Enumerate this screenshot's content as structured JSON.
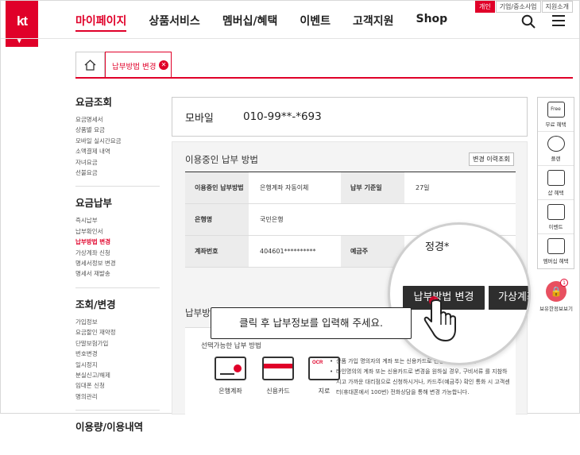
{
  "header": {
    "logo": "kt",
    "nav": [
      "마이페이지",
      "상품서비스",
      "멤버십/혜택",
      "이벤트",
      "고객지원",
      "Shop"
    ],
    "utility": [
      "개인",
      "기업/중소사업",
      "지원소개"
    ]
  },
  "tabs": {
    "active_tab": "납부방법 변경"
  },
  "sidebar": [
    {
      "title": "요금조회",
      "items": [
        "요금명세서",
        "상품별 요금",
        "모바일 실시간요금",
        "소액결제 내역",
        "자녀요금",
        "선불요금"
      ]
    },
    {
      "title": "요금납부",
      "items": [
        "즉시납부",
        "납부확인서",
        "납부방법 변경",
        "가상계좌 신청",
        "명세서정보 변경",
        "명세서 재발송"
      ],
      "active": "납부방법 변경"
    },
    {
      "title": "조회/변경",
      "items": [
        "가입정보",
        "요금할인 재약정",
        "단말보험가입",
        "번호변경",
        "일시정지",
        "분실신고/해제",
        "임대폰 신청",
        "명의관리"
      ]
    },
    {
      "title": "이용량/이용내역",
      "items": []
    }
  ],
  "mobile": {
    "label": "모바일",
    "number": "010-99**-*693"
  },
  "payment": {
    "title": "이용중인 납부 방법",
    "history_button": "변경 이력조회",
    "rows": [
      {
        "h1": "이용중인 납부방법",
        "v1": "은행계좌 자동이체",
        "h2": "납부 기준일",
        "v2": "27일"
      },
      {
        "h1": "은행명",
        "v1": "국민은행"
      },
      {
        "h1": "계좌번호",
        "v1": "404601**********",
        "h2": "예금주",
        "v2": ""
      }
    ],
    "section2_title": "납부방",
    "select_label": "선택가능한 납부 방법",
    "methods": [
      "은행계좌",
      "신용카드",
      "지로"
    ],
    "notes": [
      "상품 가입 명의자의 계좌 또는 신용카드로 변경이 가능합니다.",
      "타인명의의 계좌 또는 신용카드로 변경을 원하실 경우, 구비서류 를 지참하시고 가까운 대리점으로 신청하시거나, 카드주(예금주) 확인 통화 시 고객센터(휴대폰에서 100번) 전화상담을 통해 변경 가능합니다."
    ]
  },
  "zoom": {
    "holder_name": "정경*",
    "change_button": "납부방법 변경",
    "virtual_button": "가상계좌"
  },
  "callout": "클릭 후 납부정보를 입력해 주세요.",
  "right_quick": [
    "Free",
    "무료 혜택",
    "플랜",
    "샵 혜택",
    "이벤트",
    "멤버십 혜택"
  ],
  "lock_label": "보유한정보보기",
  "lock_badge": "1"
}
